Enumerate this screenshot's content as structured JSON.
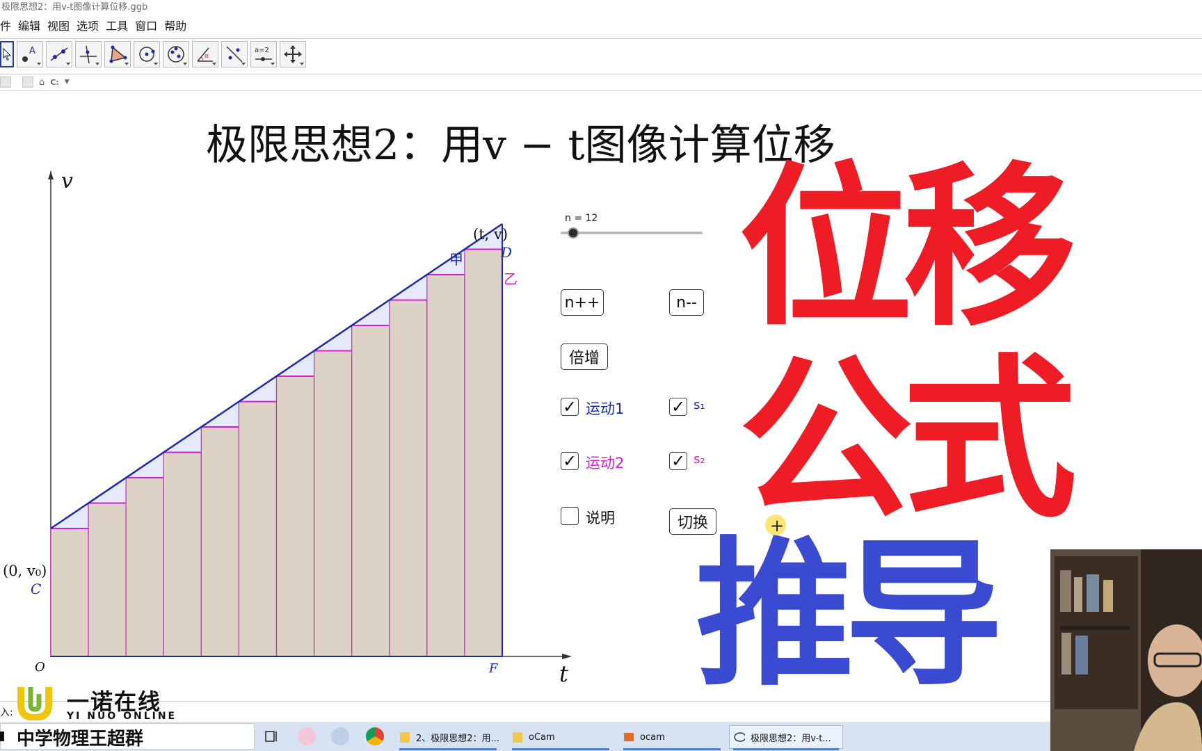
{
  "window": {
    "title": "极限思想2：用v-t图像计算位移.ggb"
  },
  "menu": [
    "件",
    "编辑",
    "视图",
    "选项",
    "工具",
    "窗口",
    "帮助"
  ],
  "toolbar": {
    "tools": [
      "move-tool",
      "point-tool",
      "line-tool",
      "perpendicular-tool",
      "polygon-tool",
      "circle-tool",
      "conic-tool",
      "angle-tool",
      "reflect-tool",
      "slider-tool",
      "move-view-tool"
    ],
    "slider_tool_text": "a=2",
    "point_tool_text": "A"
  },
  "subbar": {
    "cmd": "C:"
  },
  "graphics": {
    "title": "极限思想2：用v − t图像计算位移",
    "axis_v": "v",
    "axis_t": "t",
    "origin": "O",
    "point_C": "C",
    "point_D": "D",
    "point_F": "F",
    "coord_start": "(0, v₀)",
    "coord_end": "(t, v)",
    "label_jia": "甲",
    "label_yi": "乙",
    "n_rects": 12
  },
  "controls": {
    "slider_label": "n = 12",
    "btn_inc": "n++",
    "btn_dec": "n--",
    "btn_double": "倍增",
    "cb_motion1": "运动1",
    "cb_motion2": "运动2",
    "cb_s1": "s₁",
    "cb_s2": "s₂",
    "cb_explain": "说明",
    "btn_switch": "切换",
    "check_mark": "✓"
  },
  "overlay": {
    "line1": "位移",
    "line2": "公式",
    "line3": "推导"
  },
  "logo": {
    "cn": "一诺在线",
    "en": "YI NUO ONLINE"
  },
  "inputbar": {
    "label": "入:"
  },
  "taskbar": {
    "group": "中学物理王超群",
    "tasks": [
      "2、极限思想2：用...",
      "oCam",
      "ocam",
      "极限思想2：用v-t..."
    ]
  },
  "colors": {
    "red": "#ee1c25",
    "blue": "#3a4bd2",
    "magenta": "#d020d0",
    "navy": "#1a2aa8",
    "rect_fill": "#dcd2c6"
  }
}
